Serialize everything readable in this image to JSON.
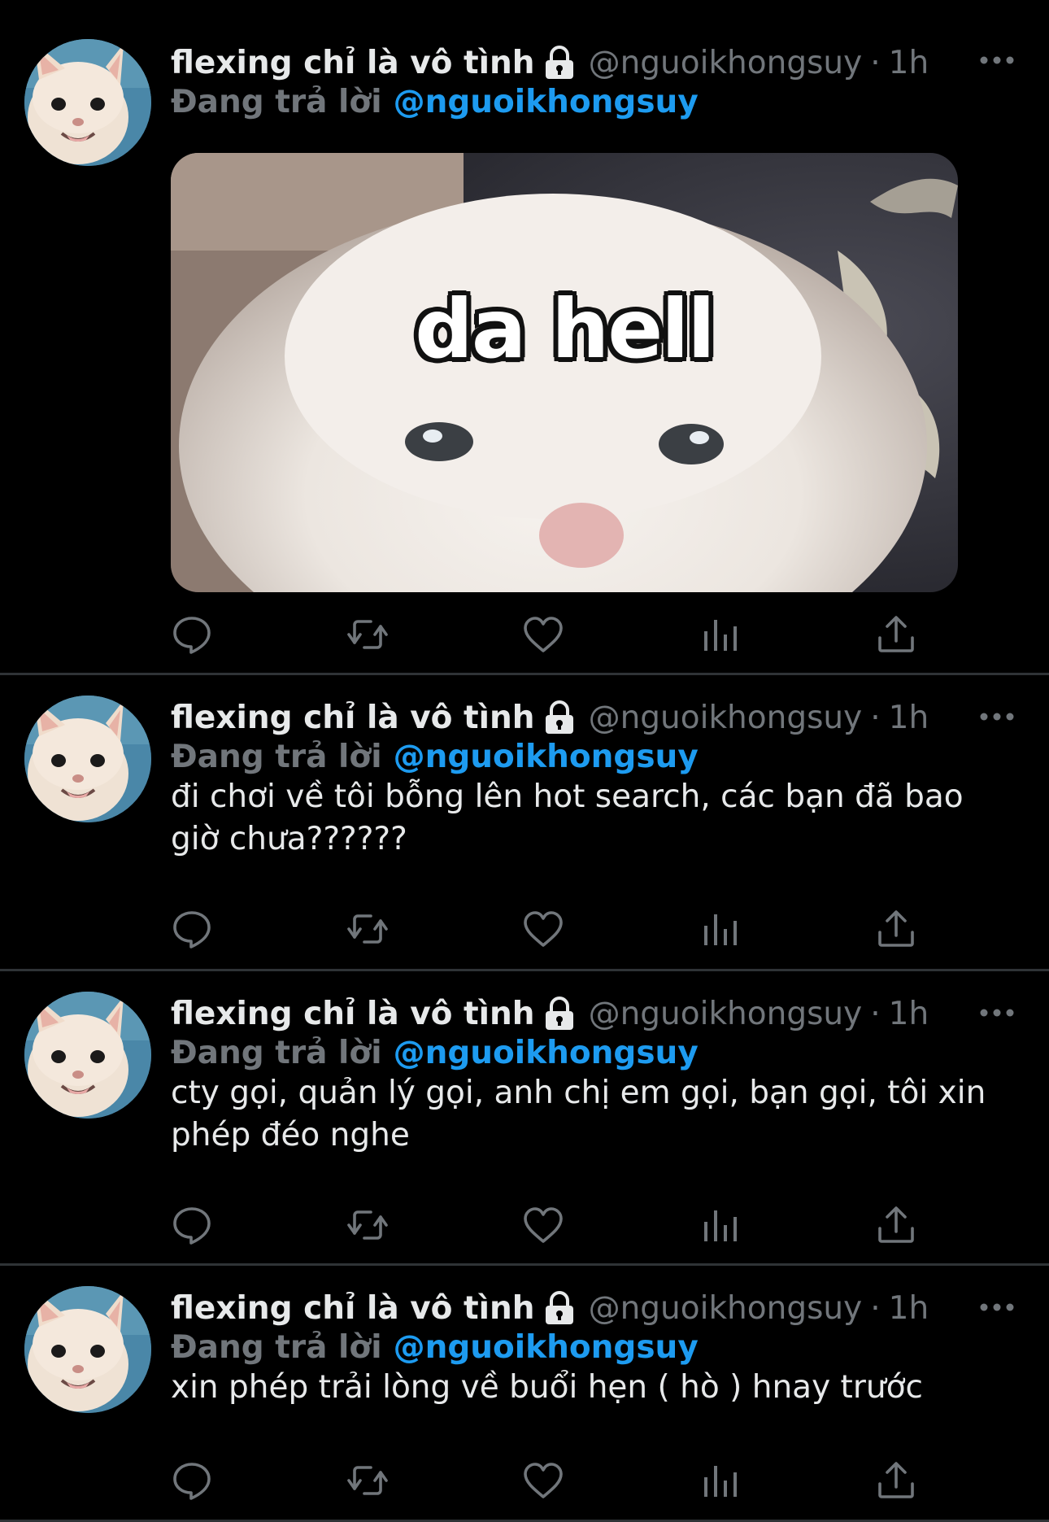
{
  "colors": {
    "background": "#000000",
    "divider": "#2f3336",
    "text_primary": "#e7e9ea",
    "text_secondary": "#71767b",
    "accent": "#1d9bf0"
  },
  "tweets": [
    {
      "display_name": "flexing chỉ là vô tình",
      "handle": "@nguoikhongsuy",
      "separator": "·",
      "time": "1h",
      "reply_prefix": "Đang trả lời",
      "reply_handle": "@nguoikhongsuy",
      "media_caption": "da hell"
    },
    {
      "display_name": "flexing chỉ là vô tình",
      "handle": "@nguoikhongsuy",
      "separator": "·",
      "time": "1h",
      "reply_prefix": "Đang trả lời",
      "reply_handle": "@nguoikhongsuy",
      "text": "đi chơi về tôi bỗng lên hot search, các bạn đã bao giờ chưa??????"
    },
    {
      "display_name": "flexing chỉ là vô tình",
      "handle": "@nguoikhongsuy",
      "separator": "·",
      "time": "1h",
      "reply_prefix": "Đang trả lời",
      "reply_handle": "@nguoikhongsuy",
      "text": "cty gọi, quản lý gọi, anh chị em gọi, bạn gọi, tôi xin phép đéo nghe"
    },
    {
      "display_name": "flexing chỉ là vô tình",
      "handle": "@nguoikhongsuy",
      "separator": "·",
      "time": "1h",
      "reply_prefix": "Đang trả lời",
      "reply_handle": "@nguoikhongsuy",
      "text": "xin phép trải lòng về buổi hẹn ( hò ) hnay trước"
    }
  ],
  "icons": {
    "avatar": "cat-avatar",
    "lock": "lock-icon",
    "more": "more-icon",
    "reply": "reply-icon",
    "retweet": "retweet-icon",
    "like": "like-icon",
    "views": "views-icon",
    "share": "share-icon"
  }
}
